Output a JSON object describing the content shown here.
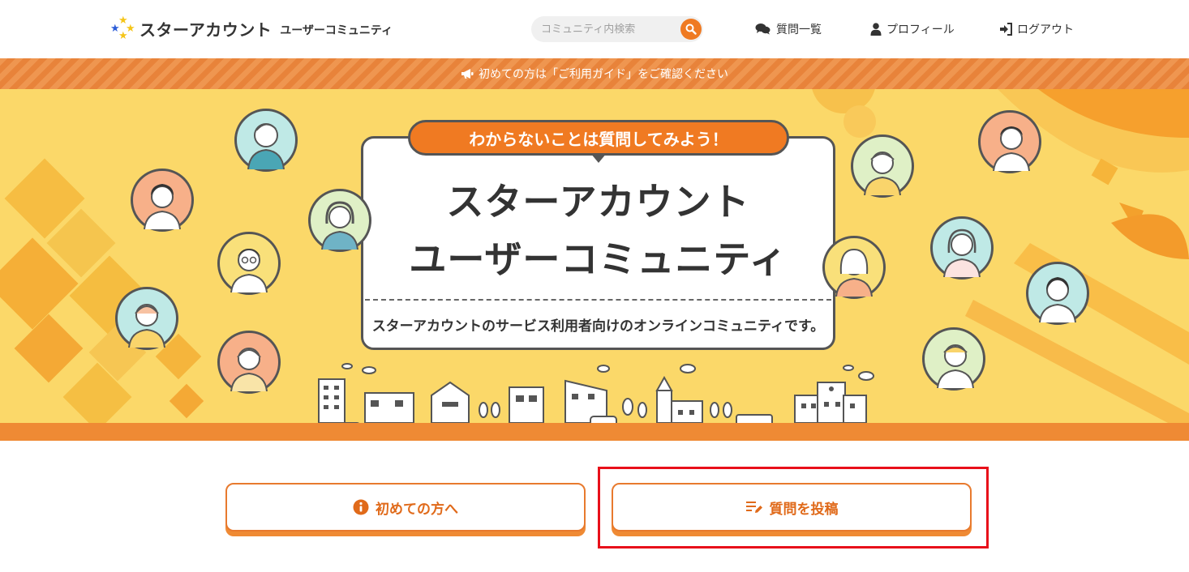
{
  "header": {
    "logo_main": "スターアカウント",
    "logo_sub": "ユーザーコミュニティ",
    "search_placeholder": "コミュニティ内検索",
    "nav": [
      {
        "label": "質問一覧",
        "icon": "comments-icon"
      },
      {
        "label": "プロフィール",
        "icon": "user-icon"
      },
      {
        "label": "ログアウト",
        "icon": "sign-out-icon"
      }
    ]
  },
  "notice": {
    "text": "初めての方は「ご利用ガイド」をご確認ください",
    "icon": "megaphone-icon"
  },
  "hero": {
    "tag": "わからないことは質問してみよう！",
    "title_line1": "スターアカウント",
    "title_line2": "ユーザーコミュニティ",
    "description": "スターアカウントのサービス利用者向けのオンラインコミュニティです。"
  },
  "actions": {
    "first_time_label": "初めての方へ",
    "post_question_label": "質問を投稿"
  },
  "colors": {
    "accent": "#ef7a22",
    "hero_bg": "#fbd869",
    "highlight": "#e8101a"
  }
}
